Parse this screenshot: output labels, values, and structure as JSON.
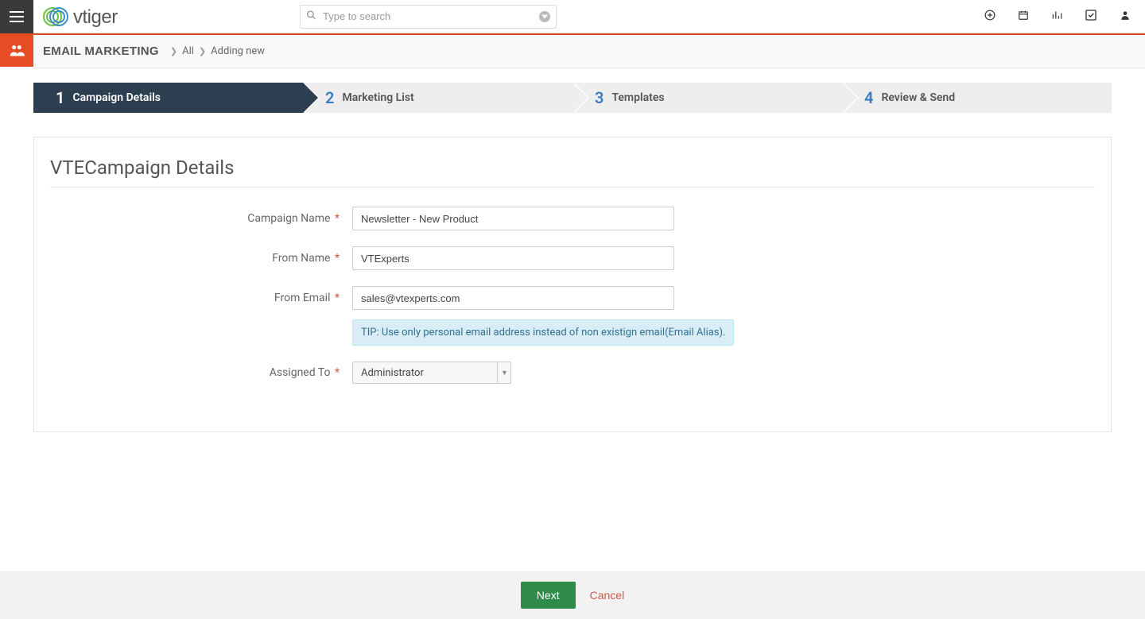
{
  "header": {
    "search_placeholder": "Type to search",
    "logo_text": "vtiger"
  },
  "breadcrumb": {
    "module": "EMAIL MARKETING",
    "link_all": "All",
    "current": "Adding new"
  },
  "steps": [
    {
      "num": "1",
      "label": "Campaign Details",
      "active": true
    },
    {
      "num": "2",
      "label": "Marketing List",
      "active": false
    },
    {
      "num": "3",
      "label": "Templates",
      "active": false
    },
    {
      "num": "4",
      "label": "Review & Send",
      "active": false
    }
  ],
  "panel": {
    "title": "VTECampaign Details"
  },
  "form": {
    "campaign_name": {
      "label": "Campaign Name",
      "value": "Newsletter - New Product"
    },
    "from_name": {
      "label": "From Name",
      "value": "VTExperts"
    },
    "from_email": {
      "label": "From Email",
      "value": "sales@vtexperts.com"
    },
    "tip": "TIP: Use only personal email address instead of non existign email(Email Alias).",
    "assigned_to": {
      "label": "Assigned To",
      "value": "Administrator"
    }
  },
  "footer": {
    "next": "Next",
    "cancel": "Cancel"
  }
}
